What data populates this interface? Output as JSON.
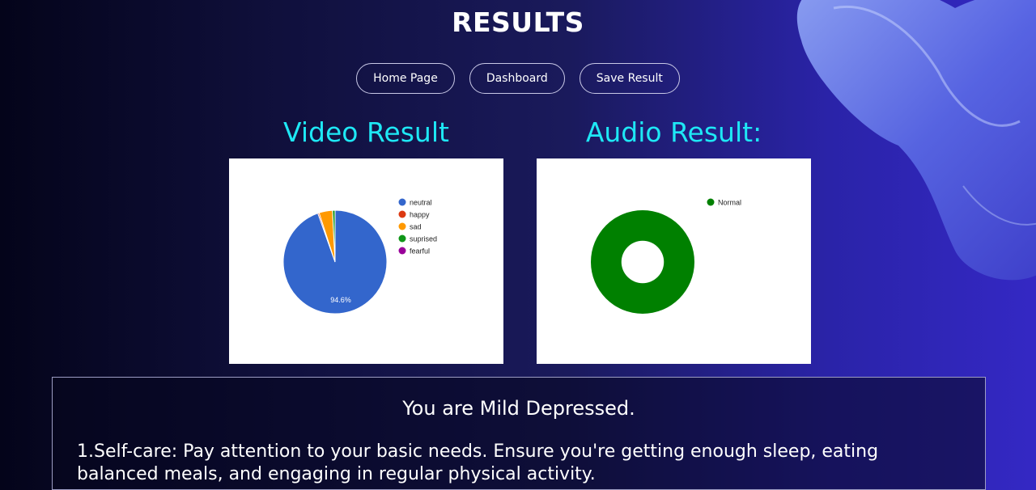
{
  "page": {
    "title": "RESULTS"
  },
  "nav": [
    {
      "label": "Home Page"
    },
    {
      "label": "Dashboard"
    },
    {
      "label": "Save Result"
    }
  ],
  "video": {
    "heading": "Video Result",
    "chart_data": {
      "type": "pie",
      "categories": [
        "neutral",
        "happy",
        "sad",
        "suprised",
        "fearful"
      ],
      "values": [
        94.6,
        0.4,
        4.2,
        0.8,
        0.0
      ],
      "colors": [
        "#3366cc",
        "#dc3912",
        "#ff9900",
        "#109618",
        "#990099"
      ],
      "slice_label": "94.6%",
      "legend_position": "right"
    }
  },
  "audio": {
    "heading": "Audio Result:",
    "chart_data": {
      "type": "pie",
      "categories": [
        "Normal"
      ],
      "values": [
        100
      ],
      "colors": [
        "#008000"
      ],
      "donut": true,
      "legend_position": "right"
    }
  },
  "result": {
    "diagnosis": "You are Mild Depressed.",
    "advice": "1.Self-care: Pay attention to your basic needs. Ensure you're getting enough sleep, eating balanced meals, and engaging in regular physical activity."
  }
}
